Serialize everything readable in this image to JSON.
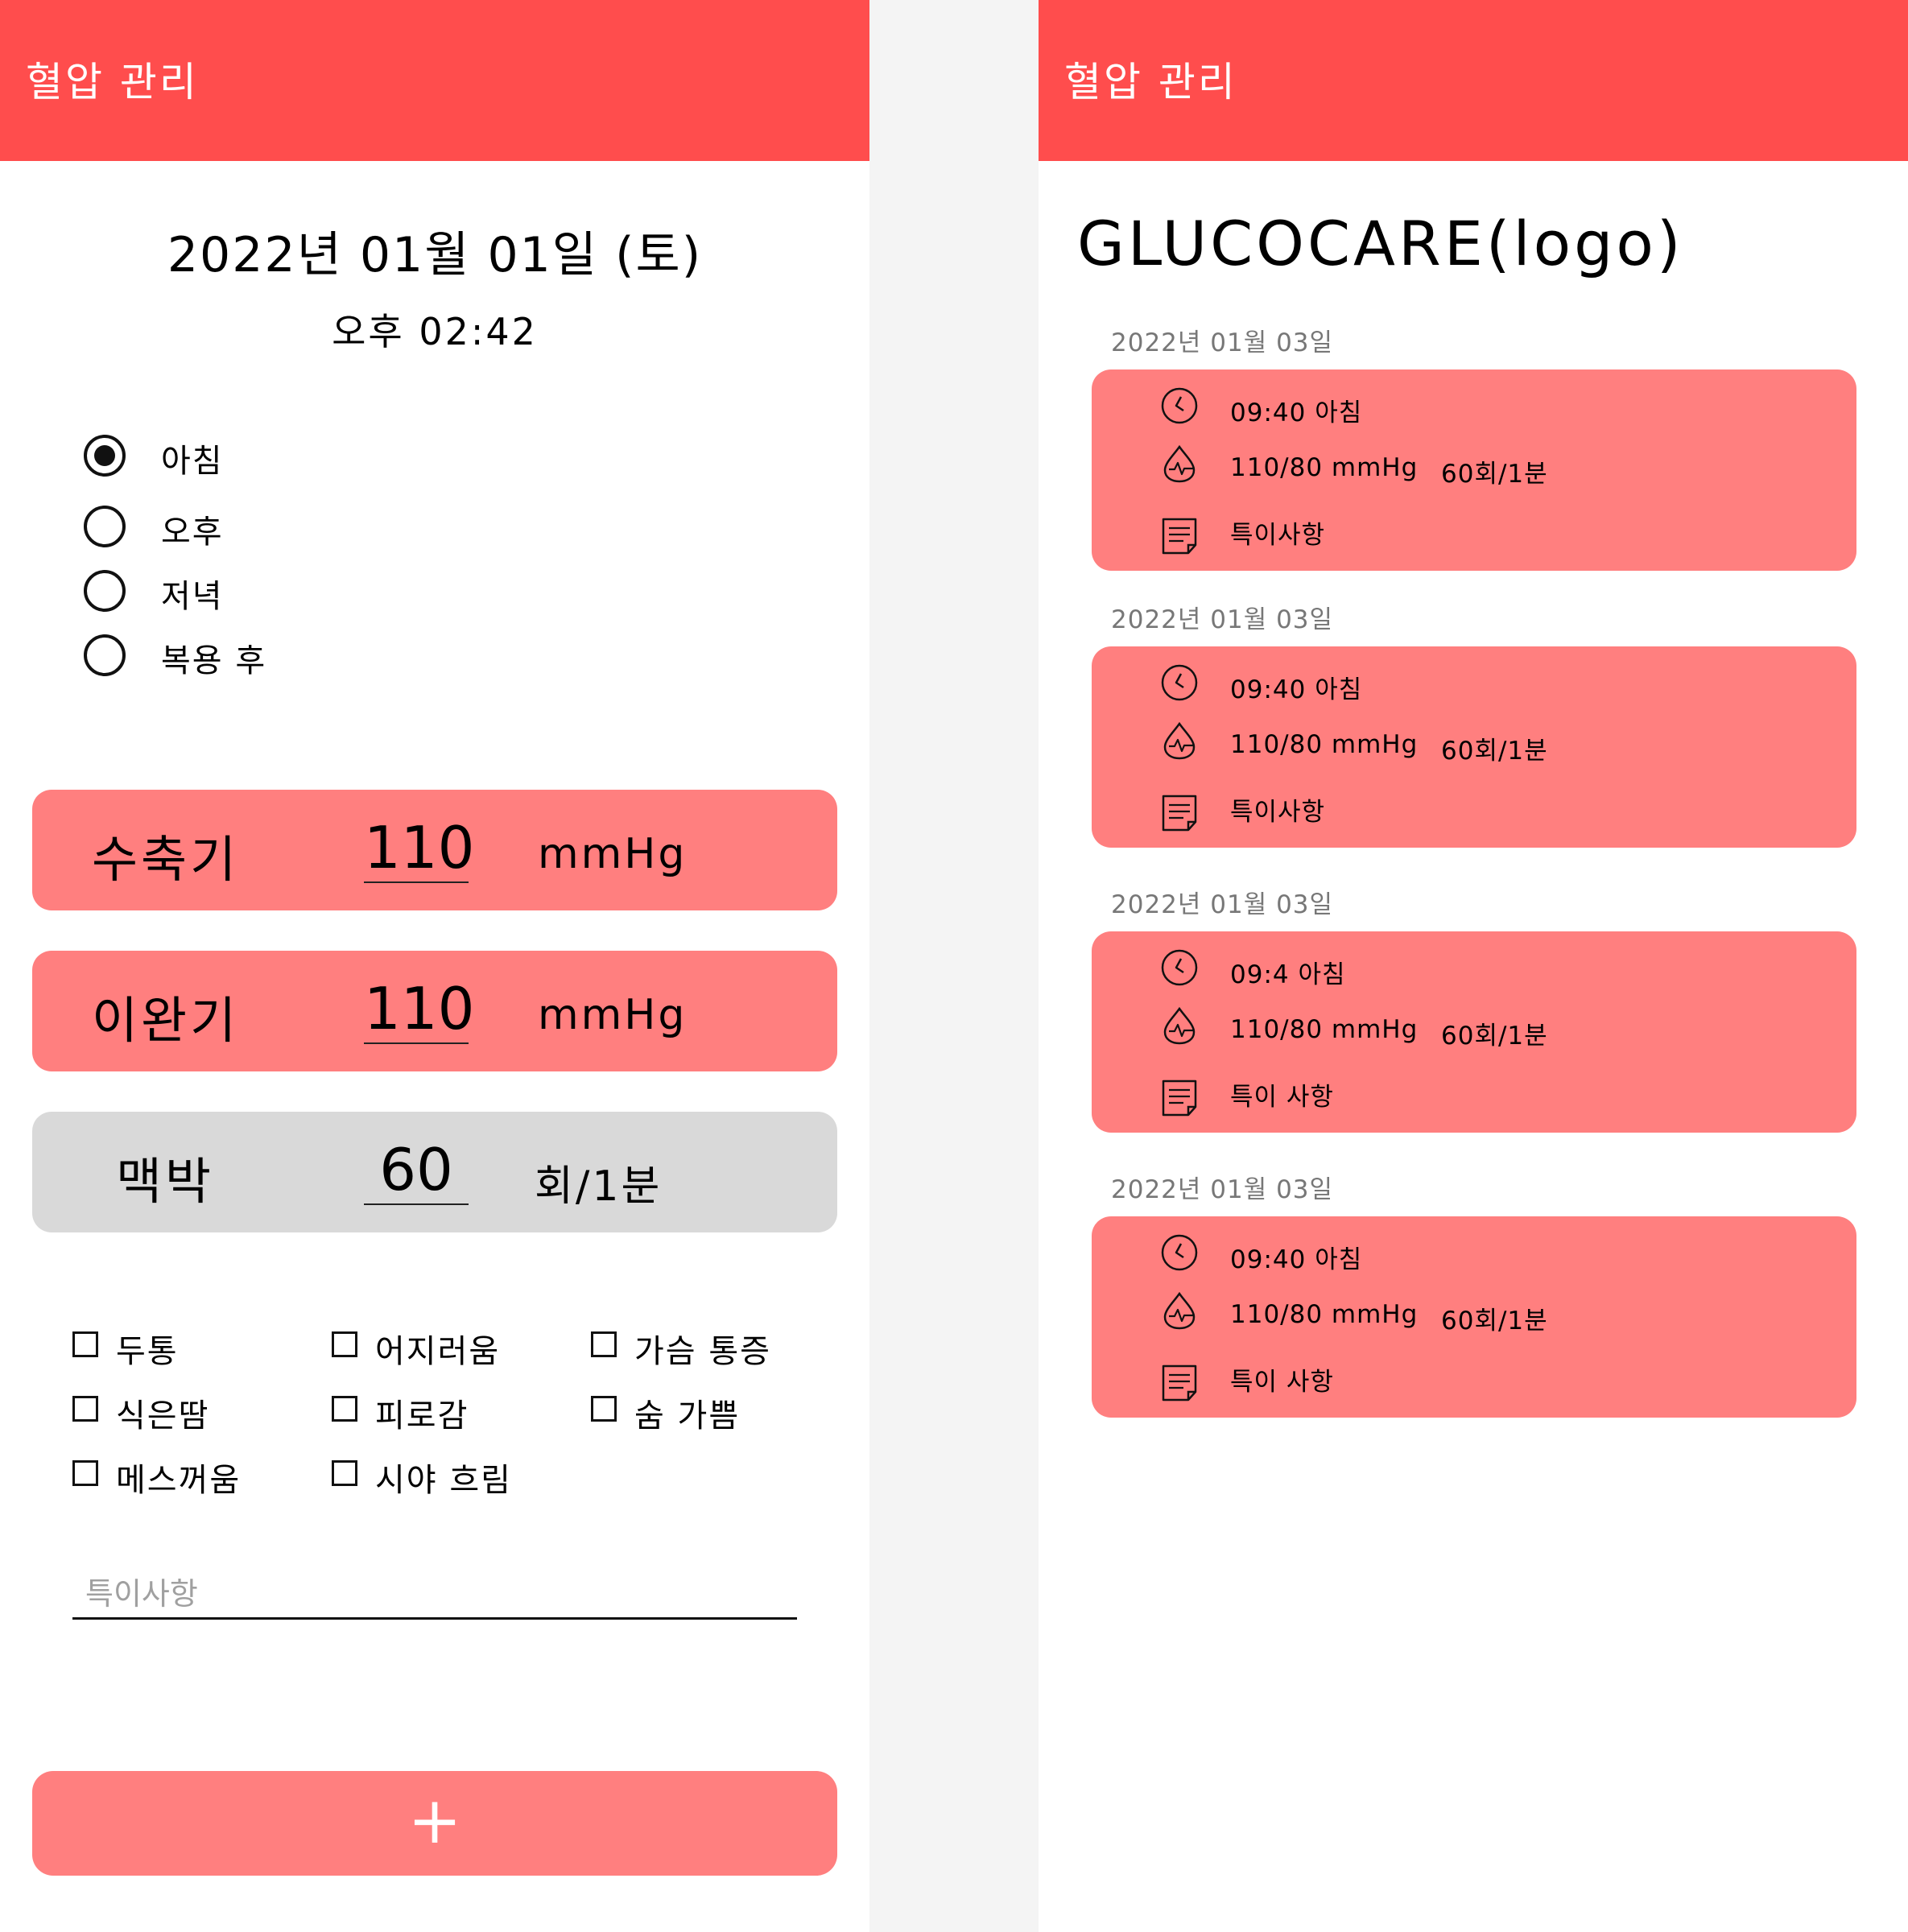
{
  "left": {
    "app_title": "혈압 관리",
    "date": "2022년 01월 01일 (토)",
    "time": "오후 02:42",
    "radio_options": [
      {
        "label": "아침",
        "selected": true
      },
      {
        "label": "오후",
        "selected": false
      },
      {
        "label": "저녁",
        "selected": false
      },
      {
        "label": "복용 후",
        "selected": false
      }
    ],
    "measurements": {
      "systolic": {
        "label": "수축기",
        "value": "110",
        "unit": "mmHg"
      },
      "diastolic": {
        "label": "이완기",
        "value": "110",
        "unit": "mmHg"
      },
      "pulse": {
        "label": "맥박",
        "value": "60",
        "unit": "회/1분"
      }
    },
    "symptoms": [
      "두통",
      "어지러움",
      "가슴 통증",
      "식은땀",
      "피로감",
      "숨 가쁨",
      "메스꺼움",
      "시야 흐림"
    ],
    "note_placeholder": "특이사항",
    "add_button_label": "+"
  },
  "right": {
    "app_title": "혈압 관리",
    "logo": "GLUCOCARE(logo)",
    "records": [
      {
        "date": "2022년 01월 03일",
        "time": "09:40 아침",
        "pressure": "110/80 mmHg",
        "pulse": "60회/1분",
        "note": "특이사항"
      },
      {
        "date": "2022년 01월 03일",
        "time": "09:40 아침",
        "pressure": "110/80 mmHg",
        "pulse": "60회/1분",
        "note": "특이사항"
      },
      {
        "date": "2022년 01월 03일",
        "time": "09:4 아침",
        "pressure": "110/80 mmHg",
        "pulse": "60회/1분",
        "note": "특이 사항"
      },
      {
        "date": "2022년 01월 03일",
        "time": "09:40 아침",
        "pressure": "110/80 mmHg",
        "pulse": "60회/1분",
        "note": "특이 사항"
      }
    ]
  },
  "colors": {
    "app_bar": "#ff4d4d",
    "card": "#ff7f7f",
    "pulse_box": "#d9d9d9",
    "background": "#f4f4f4",
    "date_label": "#777777"
  },
  "icons": {
    "record_time": "clock-icon",
    "record_pressure": "blood-drop-icon",
    "record_note": "note-icon"
  }
}
